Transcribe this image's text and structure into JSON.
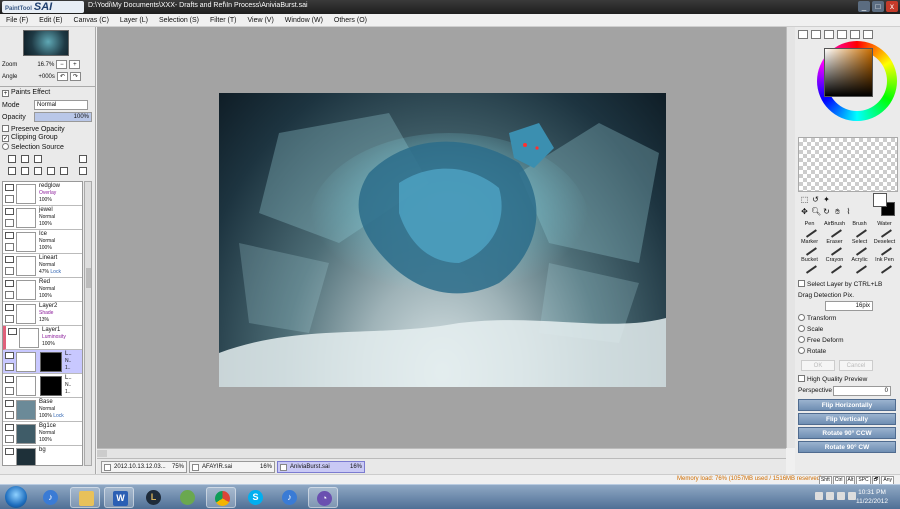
{
  "window": {
    "app_logo_prefix": "PaintTool",
    "app_logo_name": "SAI",
    "path": "D:\\Yodi\\My Documents\\XXX- Drafts and Ref\\In Process\\AniviaBurst.sai",
    "controls": [
      "_",
      "□",
      "x"
    ]
  },
  "menu": [
    "File (F)",
    "Edit (E)",
    "Canvas (C)",
    "Layer (L)",
    "Selection (S)",
    "Filter (T)",
    "View (V)",
    "Window (W)",
    "Others (O)"
  ],
  "navigator": {
    "zoom_label": "Zoom",
    "zoom_value": "16.7%",
    "angle_label": "Angle",
    "angle_value": "+000s"
  },
  "layer_props": {
    "paints_effect": "Paints Effect",
    "mode_label": "Mode",
    "mode_value": "Normal",
    "opacity_label": "Opacity",
    "opacity_value": "100%",
    "preserve_opacity": "Preserve Opacity",
    "clipping_group": "Clipping Group",
    "selection_source": "Selection Source"
  },
  "layers": [
    {
      "name": "redglow",
      "mode": "Overlay",
      "opacity": "100%",
      "mode_color": "purple",
      "lock": ""
    },
    {
      "name": "jewel",
      "mode": "Normal",
      "opacity": "100%",
      "mode_color": "",
      "lock": ""
    },
    {
      "name": "Ice",
      "mode": "Normal",
      "opacity": "100%",
      "mode_color": "",
      "lock": ""
    },
    {
      "name": "Lineart",
      "mode": "Normal",
      "opacity": "47%",
      "mode_color": "",
      "lock": "Lock"
    },
    {
      "name": "Red",
      "mode": "Normal",
      "opacity": "100%",
      "mode_color": "",
      "lock": ""
    },
    {
      "name": "Layer2",
      "mode": "Shade",
      "opacity": "13%",
      "mode_color": "purple",
      "lock": ""
    },
    {
      "name": "Layer1",
      "mode": "Luminosity",
      "opacity": "100%",
      "mode_color": "purple",
      "lock": ""
    },
    {
      "name": "L..",
      "mode": "N..",
      "opacity": "1..",
      "mode_color": "",
      "lock": ""
    },
    {
      "name": "L..",
      "mode": "N..",
      "opacity": "1..",
      "mode_color": "",
      "lock": ""
    },
    {
      "name": "Base",
      "mode": "Normal",
      "opacity": "100%",
      "mode_color": "",
      "lock": "Lock"
    },
    {
      "name": "Bg1ce",
      "mode": "Normal",
      "opacity": "100%",
      "mode_color": "",
      "lock": ""
    },
    {
      "name": "bg",
      "mode": "",
      "opacity": "",
      "mode_color": "",
      "lock": ""
    }
  ],
  "doc_tabs": [
    {
      "name": "2012.10.13.12.03...",
      "zoom": "75%"
    },
    {
      "name": "AFAYIR.sai",
      "zoom": "16%"
    },
    {
      "name": "AniviaBurst.sai",
      "zoom": "16%"
    }
  ],
  "status": {
    "memory": "Memory load: 76% (1057MB used / 1516MB reserved)",
    "keys": [
      "Shft",
      "Ctrl",
      "Alt",
      "SPC",
      "🗗",
      "Any"
    ]
  },
  "brushes": [
    "Pen",
    "AirBrush",
    "Brush",
    "Water",
    "Marker",
    "Eraser",
    "Select",
    "Deselect",
    "Bucket",
    "Crayon",
    "Acrylic",
    "Ink Pen"
  ],
  "select_tools": {
    "select_layer": "Select Layer by CTRL+LB",
    "drag_detection": "Drag Detection Pix.",
    "drag_value": "16pix",
    "transform": "Transform",
    "scale": "Scale",
    "free_deform": "Free Deform",
    "rotate": "Rotate",
    "ok": "OK",
    "cancel": "Cancel",
    "high_quality": "High Quality Preview",
    "perspective": "Perspective",
    "perspective_value": "0",
    "flip_h": "Flip Horizontally",
    "flip_v": "Flip Vertically",
    "rotate_ccw": "Rotate 90° CCW",
    "rotate_cw": "Rotate 90° CW"
  },
  "taskbar": {
    "time": "10:31 PM",
    "date": "11/22/2012"
  },
  "colors": {
    "accent": "#6f8eb3",
    "selected_layer": "#c8c8ff",
    "memory_text": "#d06d00"
  }
}
